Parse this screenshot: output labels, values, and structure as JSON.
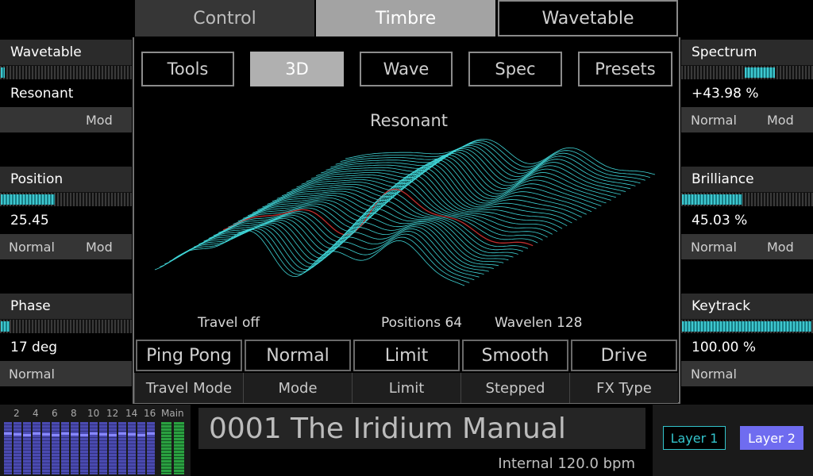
{
  "top_tabs": {
    "control": "Control",
    "timbre": "Timbre",
    "wavetable": "Wavetable"
  },
  "sub_tabs": {
    "tools": "Tools",
    "three_d": "3D",
    "wave": "Wave",
    "spec": "Spec",
    "presets": "Presets"
  },
  "left_panel": {
    "wavetable": {
      "label": "Wavetable",
      "value": "Resonant",
      "mod": "Mod",
      "level": 0.02
    },
    "position": {
      "label": "Position",
      "value": "25.45",
      "normal": "Normal",
      "mod": "Mod",
      "level": 0.42
    },
    "phase": {
      "label": "Phase",
      "value": "17 deg",
      "normal": "Normal",
      "level": 0.05
    }
  },
  "right_panel": {
    "spectrum": {
      "label": "Spectrum",
      "value": "+43.98 %",
      "normal": "Normal",
      "mod": "Mod"
    },
    "brilliance": {
      "label": "Brilliance",
      "value": "45.03 %",
      "normal": "Normal",
      "mod": "Mod",
      "level": 0.45
    },
    "keytrack": {
      "label": "Keytrack",
      "value": "100.00 %",
      "normal": "Normal",
      "level": 1.0
    }
  },
  "visualization": {
    "title": "Resonant",
    "travel": "Travel off",
    "positions": "Positions 64",
    "wavelen": "Wavelen 128",
    "accent_color": "#3fd4d6",
    "highlight_color": "#c03030"
  },
  "params": [
    {
      "value": "Ping Pong",
      "label": "Travel Mode"
    },
    {
      "value": "Normal",
      "label": "Mode"
    },
    {
      "value": "Limit",
      "label": "Limit"
    },
    {
      "value": "Smooth",
      "label": "Stepped"
    },
    {
      "value": "Drive",
      "label": "FX Type"
    }
  ],
  "mixer": {
    "channel_numbers": [
      "2",
      "4",
      "6",
      "8",
      "10",
      "12",
      "14",
      "16"
    ],
    "main_label": "Main"
  },
  "footer": {
    "patch_name": "0001 The Iridium Manual",
    "clock": "Internal 120.0 bpm",
    "layer1": "Layer 1",
    "layer2": "Layer 2"
  }
}
